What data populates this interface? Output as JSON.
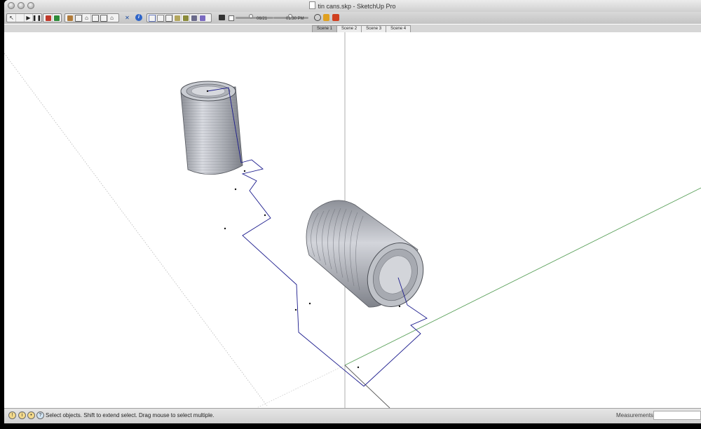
{
  "window": {
    "title": "tin cans.skp - SketchUp Pro"
  },
  "toolbar": {
    "slider_left_readout": "06/21",
    "slider_right_readout": "01:30 PM"
  },
  "scenes": [
    "Scene 1",
    "Scene 2",
    "Scene 3",
    "Scene 4"
  ],
  "status": {
    "hint": "Select objects. Shift to extend select. Drag mouse to select multiple.",
    "measurements_label": "Measurements",
    "measurements_value": ""
  },
  "colors": {
    "green_axis": "#5aa05a",
    "path_blue": "#1a1a8c",
    "can_gray": "#b5b8c0"
  }
}
